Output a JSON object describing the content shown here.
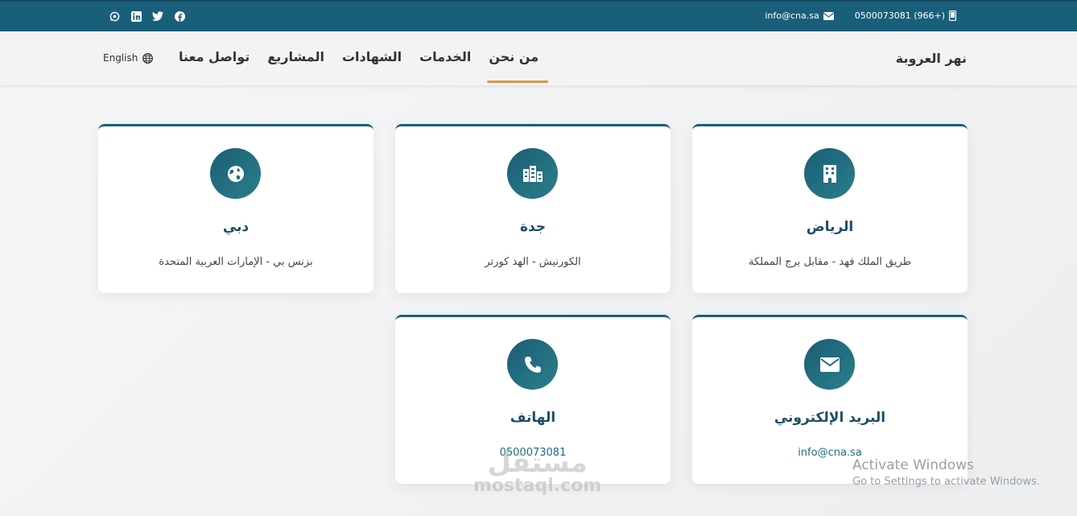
{
  "topbar": {
    "phone": "0500073081 (966+)",
    "email": "info@cna.sa",
    "social": [
      "whatsapp-icon",
      "linkedin-icon",
      "twitter-icon",
      "facebook-icon"
    ]
  },
  "nav": {
    "brand": "نهر العروبة",
    "items": [
      {
        "label": "من نحن",
        "active": true
      },
      {
        "label": "الخدمات"
      },
      {
        "label": "الشهادات"
      },
      {
        "label": "المشاريع"
      },
      {
        "label": "تواصل معنا"
      }
    ],
    "lang": "English"
  },
  "cards": [
    {
      "icon": "building-icon",
      "title": "الرياض",
      "desc": "طريق الملك فهد - مقابل برج المملكة"
    },
    {
      "icon": "city-icon",
      "title": "جدة",
      "desc": "الكورنيش - الهد كورتر"
    },
    {
      "icon": "globe-icon",
      "title": "دبي",
      "desc": "بزنس بي - الإمارات العربية المتحدة"
    },
    {
      "icon": "envelope-icon",
      "title": "البريد الإلكتروني",
      "desc": "info@cna.sa"
    },
    {
      "icon": "phone-icon",
      "title": "الهاتف",
      "desc": "0500073081"
    }
  ],
  "watermark": {
    "activate_title": "Activate Windows",
    "activate_sub": "Go to Settings to activate Windows.",
    "mostaql_ar": "مستقل",
    "mostaql_en": "mostaql.com"
  },
  "colors": {
    "primary": "#1a5f7a",
    "accent": "#d49a4a"
  }
}
